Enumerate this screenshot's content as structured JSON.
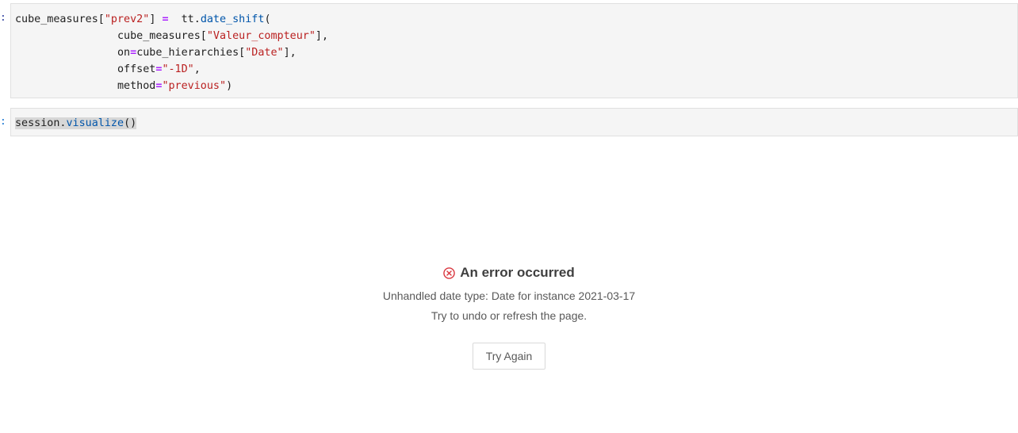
{
  "cells": [
    {
      "prompt": ":",
      "lines": [
        [
          {
            "t": "cube_measures[",
            "k": "plain"
          },
          {
            "t": "\"prev2\"",
            "k": "str"
          },
          {
            "t": "] ",
            "k": "plain"
          },
          {
            "t": "=",
            "k": "op"
          },
          {
            "t": "  tt.",
            "k": "plain"
          },
          {
            "t": "date_shift",
            "k": "fn"
          },
          {
            "t": "(",
            "k": "plain"
          }
        ],
        [
          {
            "t": "                cube_measures[",
            "k": "plain"
          },
          {
            "t": "\"Valeur_compteur\"",
            "k": "str"
          },
          {
            "t": "],",
            "k": "plain"
          }
        ],
        [
          {
            "t": "                on",
            "k": "plain"
          },
          {
            "t": "=",
            "k": "op"
          },
          {
            "t": "cube_hierarchies[",
            "k": "plain"
          },
          {
            "t": "\"Date\"",
            "k": "str"
          },
          {
            "t": "],",
            "k": "plain"
          }
        ],
        [
          {
            "t": "                offset",
            "k": "plain"
          },
          {
            "t": "=",
            "k": "op"
          },
          {
            "t": "\"-1D\"",
            "k": "str"
          },
          {
            "t": ",",
            "k": "plain"
          }
        ],
        [
          {
            "t": "                method",
            "k": "plain"
          },
          {
            "t": "=",
            "k": "op"
          },
          {
            "t": "\"previous\"",
            "k": "str"
          },
          {
            "t": ")",
            "k": "plain"
          }
        ]
      ]
    },
    {
      "prompt": ":",
      "lines": [
        [
          {
            "t": "session.",
            "k": "plain"
          },
          {
            "t": "visualize",
            "k": "fn"
          },
          {
            "t": "()",
            "k": "plain"
          }
        ]
      ]
    }
  ],
  "error": {
    "icon": "close-circle-icon",
    "title": "An error occurred",
    "message": "Unhandled date type: Date for instance 2021-03-17",
    "hint": "Try to undo or refresh the page.",
    "button_label": "Try Again",
    "accent_color": "#d9363e"
  }
}
